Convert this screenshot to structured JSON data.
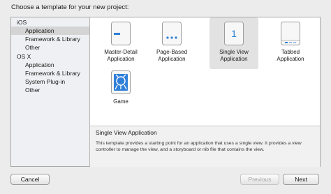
{
  "header": {
    "title": "Choose a template for your new project:"
  },
  "sidebar": {
    "groups": [
      {
        "label": "iOS",
        "items": [
          "Application",
          "Framework & Library",
          "Other"
        ]
      },
      {
        "label": "OS X",
        "items": [
          "Application",
          "Framework & Library",
          "System Plug-in",
          "Other"
        ]
      }
    ],
    "selected": "iOS / Application"
  },
  "templates": [
    {
      "label_line1": "Master-Detail",
      "label_line2": "Application",
      "icon": "master-detail-icon"
    },
    {
      "label_line1": "Page-Based",
      "label_line2": "Application",
      "icon": "page-based-icon"
    },
    {
      "label_line1": "Single View",
      "label_line2": "Application",
      "icon": "single-view-icon",
      "icon_text": "1",
      "selected": true
    },
    {
      "label_line1": "Tabbed",
      "label_line2": "Application",
      "icon": "tabbed-icon"
    },
    {
      "label_line1": "Game",
      "label_line2": "",
      "icon": "game-icon"
    }
  ],
  "description": {
    "title": "Single View Application",
    "text": "This template provides a starting point for an application that uses a single view. It provides a view controller to manage the view, and a storyboard or nib file that contains the view."
  },
  "buttons": {
    "cancel": "Cancel",
    "previous": "Previous",
    "next": "Next"
  },
  "colors": {
    "icon_blue": "#2f7fd8",
    "selection_gray": "#d4d4d4"
  }
}
